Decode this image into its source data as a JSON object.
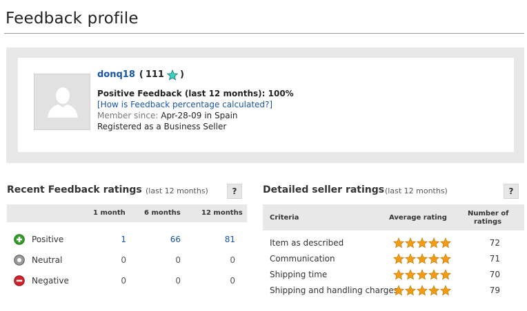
{
  "page": {
    "title": "Feedback profile"
  },
  "profile": {
    "username": "donq18",
    "open_paren": "(",
    "score": "111",
    "close_paren": ")",
    "positive_feedback": "Positive Feedback (last 12 months): 100%",
    "help_link": "[How is Feedback percentage calculated?]",
    "member_since_label": "Member since:",
    "member_since_value": "Apr-28-09 in Spain",
    "seller_type": "Registered as a Business Seller",
    "star_color": "#3fd0c4"
  },
  "recent": {
    "title": "Recent Feedback ratings",
    "subtitle": "(last 12 months)",
    "help": "?",
    "headers": [
      "1 month",
      "6 months",
      "12 months"
    ],
    "rows": [
      {
        "label": "Positive",
        "icon": "positive-plus-icon",
        "color": "#3a9e2c",
        "values": [
          "1",
          "66",
          "81"
        ]
      },
      {
        "label": "Neutral",
        "icon": "neutral-dot-icon",
        "color": "#888888",
        "values": [
          "0",
          "0",
          "0"
        ]
      },
      {
        "label": "Negative",
        "icon": "negative-minus-icon",
        "color": "#d2232a",
        "values": [
          "0",
          "0",
          "0"
        ]
      }
    ]
  },
  "detailed": {
    "title": "Detailed seller ratings",
    "subtitle": "(last 12 months)",
    "help": "?",
    "headers": {
      "criteria": "Criteria",
      "avg": "Average rating",
      "num1": "Number of",
      "num2": "ratings"
    },
    "rows": [
      {
        "criteria": "Item as described",
        "stars": 5,
        "count": "72"
      },
      {
        "criteria": "Communication",
        "stars": 5,
        "count": "71"
      },
      {
        "criteria": "Shipping time",
        "stars": 5,
        "count": "70"
      },
      {
        "criteria": "Shipping and handling charges",
        "stars": 5,
        "count": "79"
      }
    ],
    "star_color": "#f39c12"
  }
}
